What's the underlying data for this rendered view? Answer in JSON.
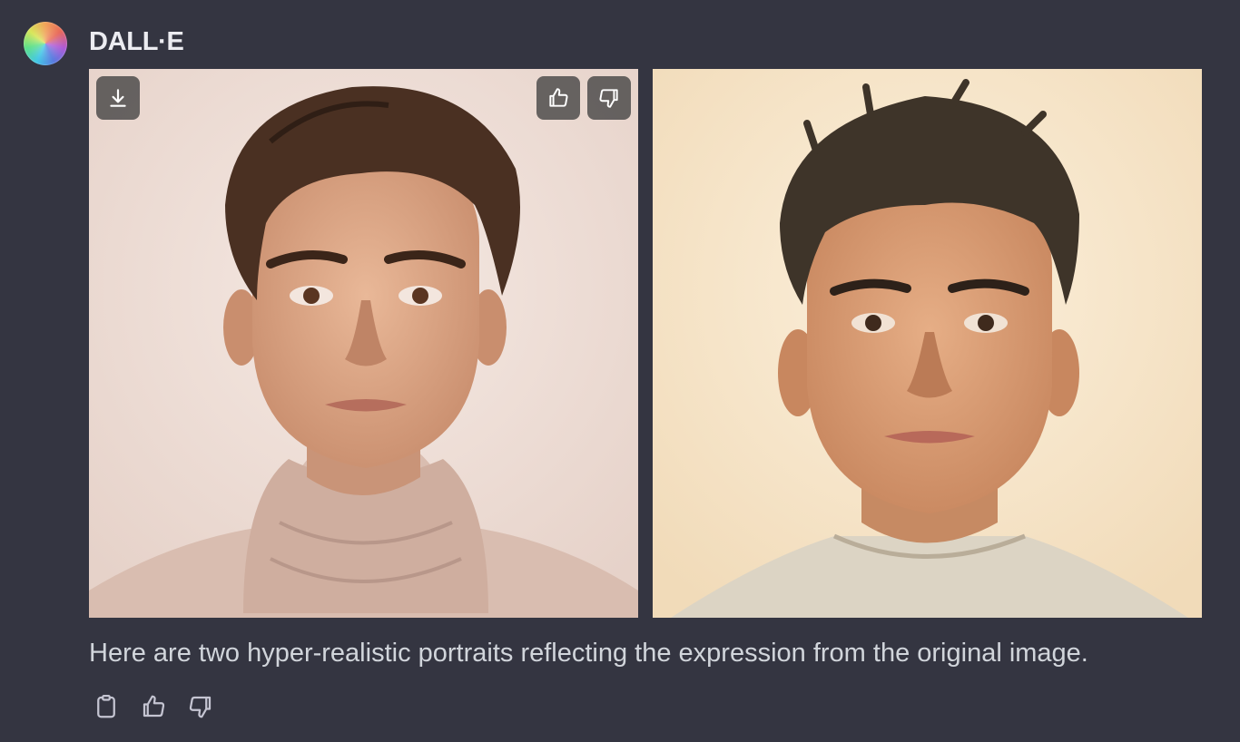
{
  "message": {
    "author": "DALL·E",
    "caption": "Here are two hyper-realistic portraits reflecting the expression from the original image."
  },
  "images": [
    {
      "icon": "portrait-image",
      "background": "#eddbd3"
    },
    {
      "icon": "portrait-image",
      "background": "#f6e4c6"
    }
  ],
  "image_overlay": {
    "download_icon": "download-icon",
    "thumbs_up_icon": "thumbs-up-icon",
    "thumbs_down_icon": "thumbs-down-icon"
  },
  "message_actions": [
    {
      "icon": "clipboard-icon"
    },
    {
      "icon": "thumbs-up-icon"
    },
    {
      "icon": "thumbs-down-icon"
    }
  ],
  "colors": {
    "background": "#343541",
    "text_primary": "#ececf1",
    "text_secondary": "#d1d5db",
    "icon": "#c5c5d2"
  }
}
